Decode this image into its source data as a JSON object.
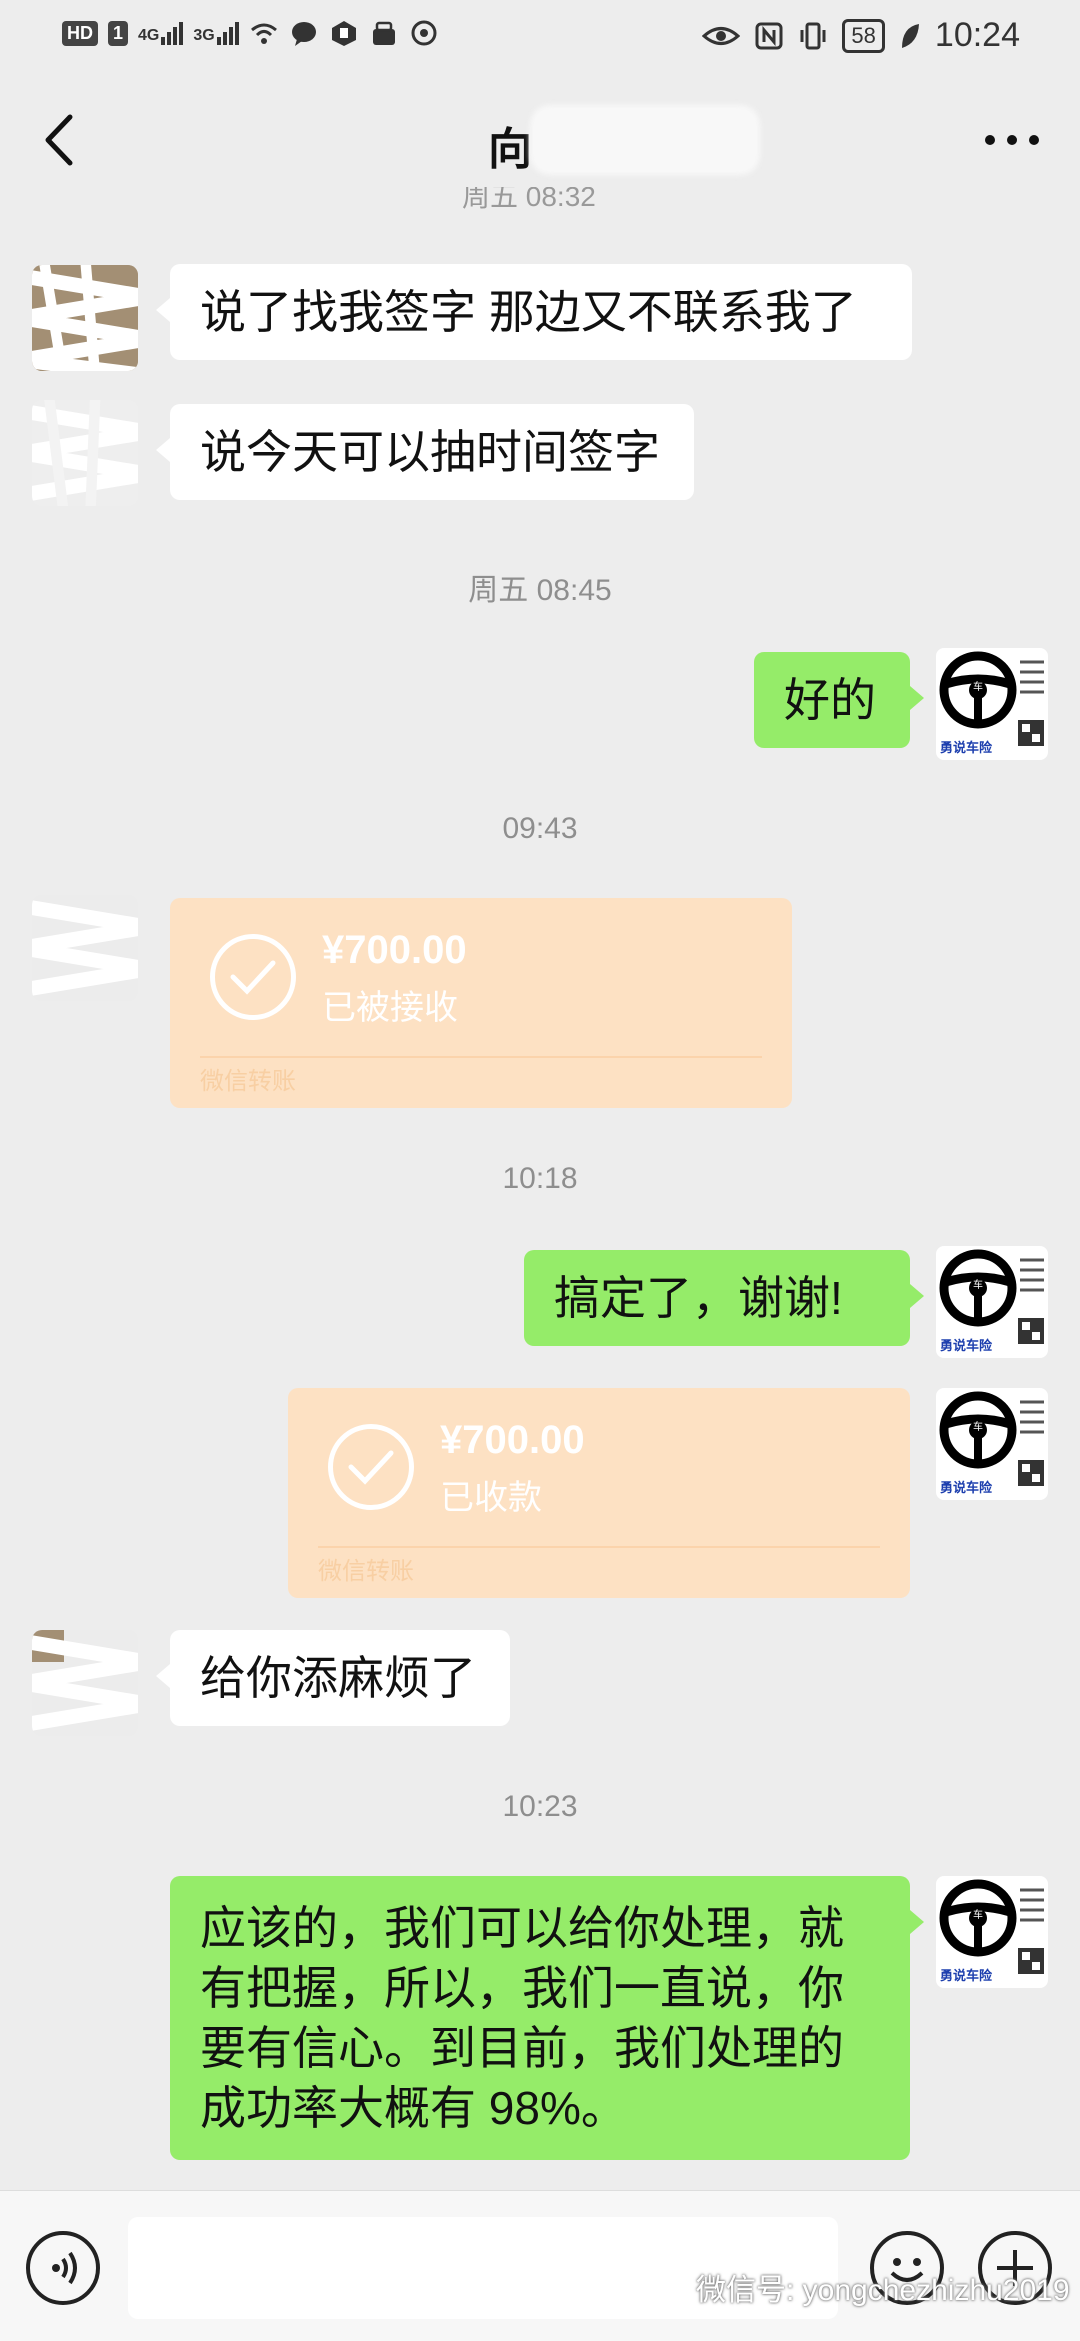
{
  "status_bar": {
    "hd_label": "HD",
    "sim1_label": "1",
    "net1": "4G",
    "net2": "3G",
    "battery": "58",
    "time": "10:24"
  },
  "header": {
    "title": "向",
    "partial_timestamp": "周五 08:32"
  },
  "messages": [
    {
      "text": "说了找我签字 那边又不联系我了"
    },
    {
      "text": "说今天可以抽时间签字"
    },
    {
      "timestamp": "周五 08:45"
    },
    {
      "text": "好的"
    },
    {
      "timestamp": "09:43"
    },
    {
      "amount": "¥700.00",
      "status": "已被接收",
      "brand": "微信转账"
    },
    {
      "timestamp": "10:18"
    },
    {
      "text": "搞定了，谢谢!"
    },
    {
      "amount": "¥700.00",
      "status": "已收款",
      "brand": "微信转账"
    },
    {
      "text": "给你添麻烦了"
    },
    {
      "timestamp": "10:23"
    },
    {
      "text": "应该的，我们可以给你处理，就有把握，所以，我们一直说，你要有信心。到目前，我们处理的成功率大概有 98%。"
    }
  ],
  "avatar_right": {
    "car_char": "车",
    "brand": "勇说车险"
  },
  "input": {
    "value": "",
    "placeholder": ""
  },
  "watermark": {
    "text": "微信号: yongchezhizhu2019"
  },
  "colors": {
    "background": "#ededed",
    "outgoing_bubble": "#95ec69",
    "incoming_bubble": "#ffffff",
    "transfer_card": "#fde1c3"
  }
}
